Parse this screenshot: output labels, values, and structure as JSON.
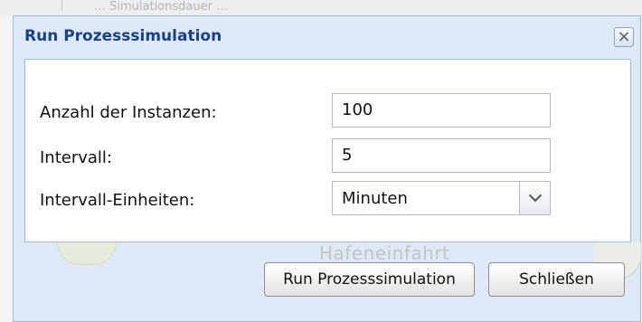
{
  "background": {
    "partial_text": "… Simulationsdauer …",
    "diagram_label": "Hafeneinfahrt"
  },
  "dialog": {
    "title": "Run Prozesssimulation",
    "close_symbol": "×",
    "fields": {
      "instances": {
        "label": "Anzahl der Instanzen:",
        "value": "100"
      },
      "interval": {
        "label": "Intervall:",
        "value": "5"
      },
      "units": {
        "label": "Intervall-Einheiten:",
        "value": "Minuten",
        "icon": "chevron-down-icon"
      }
    },
    "buttons": {
      "run": "Run Prozesssimulation",
      "close": "Schließen"
    }
  },
  "colors": {
    "title": "#15428b",
    "window_bg": "#dfe8f6",
    "border": "#99bbe8"
  }
}
